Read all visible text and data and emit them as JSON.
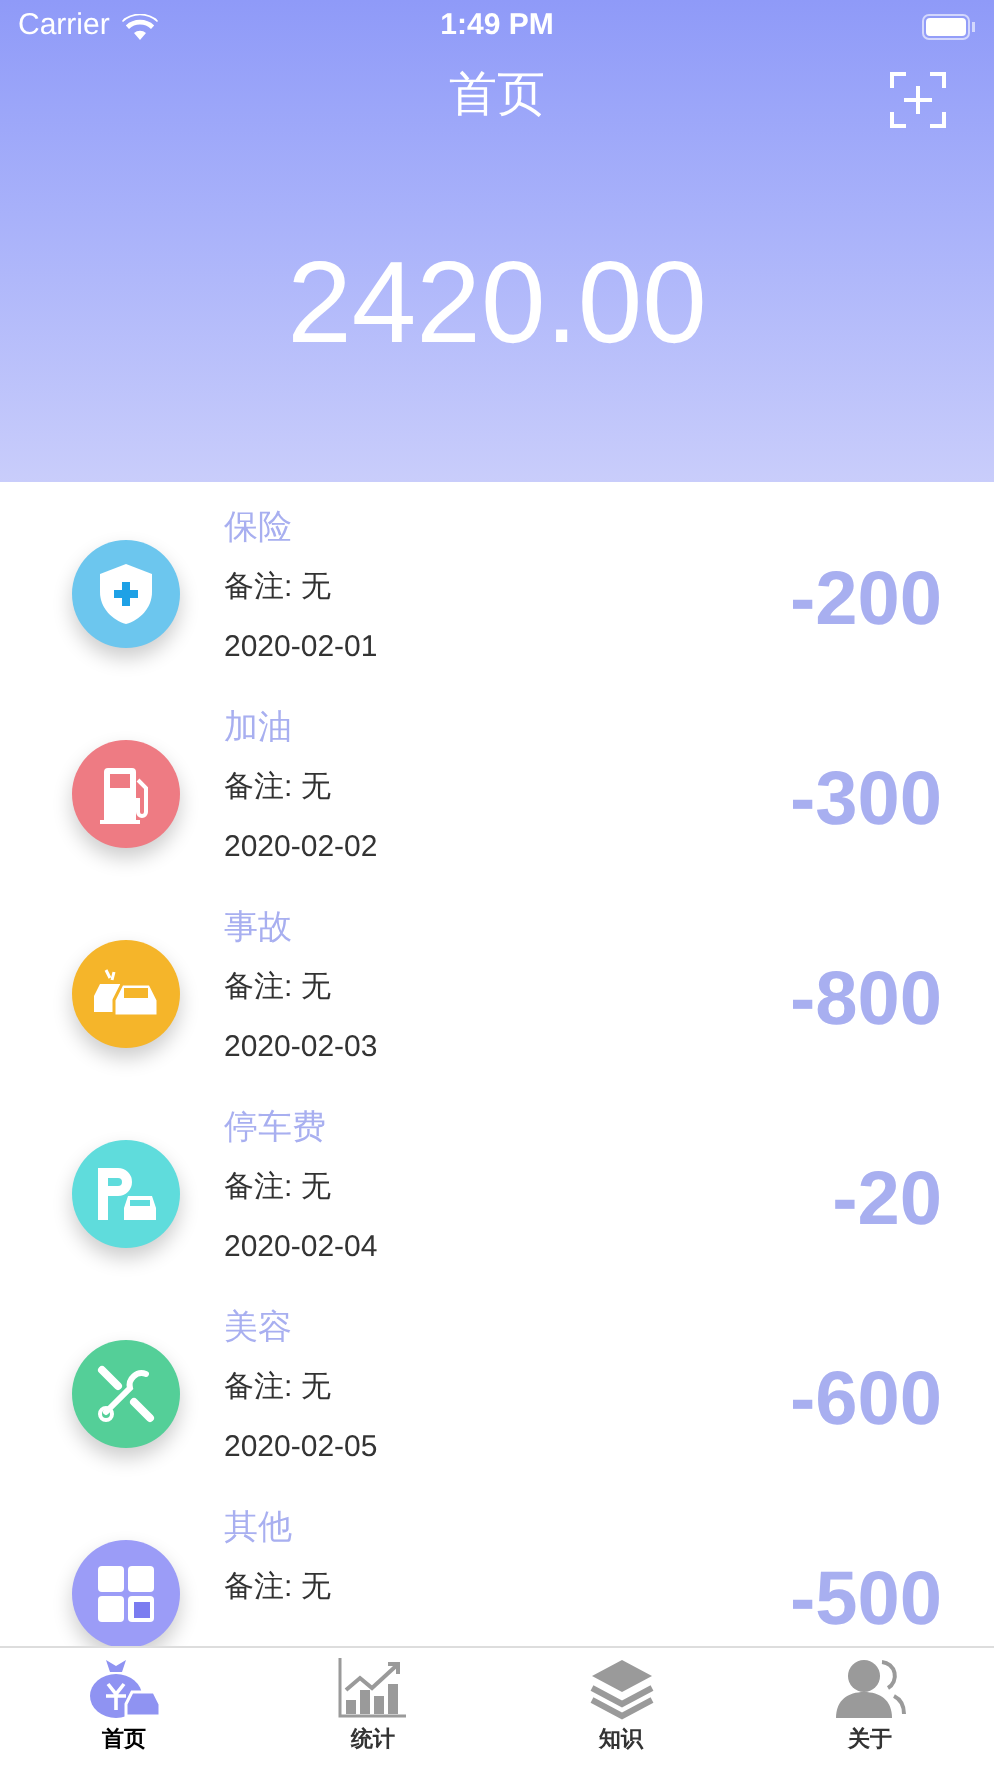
{
  "status_bar": {
    "carrier": "Carrier",
    "time": "1:49 PM"
  },
  "nav": {
    "title": "首页"
  },
  "balance": "2420.00",
  "records": [
    {
      "kind": "insurance",
      "color": "#6cc6ee",
      "category": "保险",
      "note": "备注: 无",
      "date": "2020-02-01",
      "amount": "-200"
    },
    {
      "kind": "fuel",
      "color": "#ee7b83",
      "category": "加油",
      "note": "备注: 无",
      "date": "2020-02-02",
      "amount": "-300"
    },
    {
      "kind": "accident",
      "color": "#f5b52a",
      "category": "事故",
      "note": "备注: 无",
      "date": "2020-02-03",
      "amount": "-800"
    },
    {
      "kind": "parking",
      "color": "#5fdcdc",
      "category": "停车费",
      "note": "备注: 无",
      "date": "2020-02-04",
      "amount": "-20"
    },
    {
      "kind": "beauty",
      "color": "#54cf98",
      "category": "美容",
      "note": "备注: 无",
      "date": "2020-02-05",
      "amount": "-600"
    },
    {
      "kind": "other",
      "color": "#9b9cf7",
      "category": "其他",
      "note": "备注: 无",
      "amount": "-500"
    }
  ],
  "tabs": [
    {
      "kind": "home",
      "label": "首页",
      "selected": true
    },
    {
      "kind": "stats",
      "label": "统计",
      "selected": false
    },
    {
      "kind": "knowledge",
      "label": "知识",
      "selected": false
    },
    {
      "kind": "about",
      "label": "关于",
      "selected": false
    }
  ]
}
